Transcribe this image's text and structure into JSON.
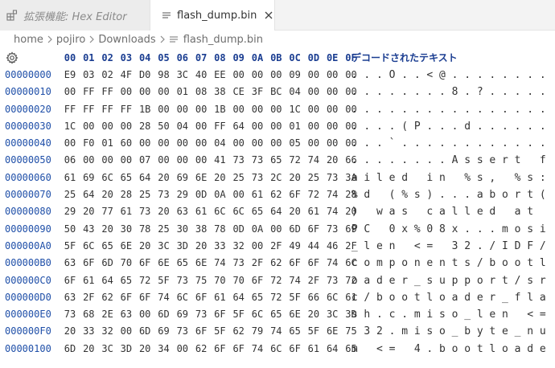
{
  "tabs": [
    {
      "label": "拡張機能: Hex Editor",
      "icon": "extensions-icon",
      "active": false
    },
    {
      "label": "flash_dump.bin",
      "icon": "file-icon",
      "active": true,
      "close": "close-icon"
    }
  ],
  "breadcrumb": [
    "home",
    "pojiro",
    "Downloads",
    "flash_dump.bin"
  ],
  "editor": {
    "column_headers": [
      "00",
      "01",
      "02",
      "03",
      "04",
      "05",
      "06",
      "07",
      "08",
      "09",
      "0A",
      "0B",
      "0C",
      "0D",
      "0E",
      "0F"
    ],
    "decoded_header": "デコードされたテキスト",
    "rows": [
      {
        "addr": "00000000",
        "hex": [
          "E9",
          "03",
          "02",
          "4F",
          "D0",
          "98",
          "3C",
          "40",
          "EE",
          "00",
          "00",
          "00",
          "09",
          "00",
          "00",
          "00"
        ],
        "ascii": [
          ".",
          ".",
          ".",
          "O",
          ".",
          ".",
          "<",
          "@",
          ".",
          ".",
          ".",
          ".",
          ".",
          ".",
          ".",
          "."
        ]
      },
      {
        "addr": "00000010",
        "hex": [
          "00",
          "FF",
          "FF",
          "00",
          "00",
          "00",
          "01",
          "08",
          "38",
          "CE",
          "3F",
          "BC",
          "04",
          "00",
          "00",
          "00"
        ],
        "ascii": [
          ".",
          ".",
          ".",
          ".",
          ".",
          ".",
          ".",
          ".",
          "8",
          ".",
          "?",
          ".",
          ".",
          ".",
          ".",
          "."
        ]
      },
      {
        "addr": "00000020",
        "hex": [
          "FF",
          "FF",
          "FF",
          "FF",
          "1B",
          "00",
          "00",
          "00",
          "1B",
          "00",
          "00",
          "00",
          "1C",
          "00",
          "00",
          "00"
        ],
        "ascii": [
          ".",
          ".",
          ".",
          ".",
          ".",
          ".",
          ".",
          ".",
          ".",
          ".",
          ".",
          ".",
          ".",
          ".",
          ".",
          "."
        ]
      },
      {
        "addr": "00000030",
        "hex": [
          "1C",
          "00",
          "00",
          "00",
          "28",
          "50",
          "04",
          "00",
          "FF",
          "64",
          "00",
          "00",
          "01",
          "00",
          "00",
          "00"
        ],
        "ascii": [
          ".",
          ".",
          ".",
          ".",
          "(",
          "P",
          ".",
          ".",
          ".",
          "d",
          ".",
          ".",
          ".",
          ".",
          ".",
          "."
        ]
      },
      {
        "addr": "00000040",
        "hex": [
          "00",
          "F0",
          "01",
          "60",
          "00",
          "00",
          "00",
          "00",
          "04",
          "00",
          "00",
          "00",
          "05",
          "00",
          "00",
          "00"
        ],
        "ascii": [
          ".",
          ".",
          ".",
          "`",
          ".",
          ".",
          ".",
          ".",
          ".",
          ".",
          ".",
          ".",
          ".",
          ".",
          ".",
          "."
        ]
      },
      {
        "addr": "00000050",
        "hex": [
          "06",
          "00",
          "00",
          "00",
          "07",
          "00",
          "00",
          "00",
          "41",
          "73",
          "73",
          "65",
          "72",
          "74",
          "20",
          "66"
        ],
        "ascii": [
          ".",
          ".",
          ".",
          ".",
          ".",
          ".",
          ".",
          ".",
          "A",
          "s",
          "s",
          "e",
          "r",
          "t",
          " ",
          "f"
        ]
      },
      {
        "addr": "00000060",
        "hex": [
          "61",
          "69",
          "6C",
          "65",
          "64",
          "20",
          "69",
          "6E",
          "20",
          "25",
          "73",
          "2C",
          "20",
          "25",
          "73",
          "3A"
        ],
        "ascii": [
          "a",
          "i",
          "l",
          "e",
          "d",
          " ",
          "i",
          "n",
          " ",
          "%",
          "s",
          ",",
          " ",
          "%",
          "s",
          ":"
        ]
      },
      {
        "addr": "00000070",
        "hex": [
          "25",
          "64",
          "20",
          "28",
          "25",
          "73",
          "29",
          "0D",
          "0A",
          "00",
          "61",
          "62",
          "6F",
          "72",
          "74",
          "28"
        ],
        "ascii": [
          "%",
          "d",
          " ",
          "(",
          "%",
          "s",
          ")",
          ".",
          ".",
          ".",
          "a",
          "b",
          "o",
          "r",
          "t",
          "("
        ]
      },
      {
        "addr": "00000080",
        "hex": [
          "29",
          "20",
          "77",
          "61",
          "73",
          "20",
          "63",
          "61",
          "6C",
          "6C",
          "65",
          "64",
          "20",
          "61",
          "74",
          "20"
        ],
        "ascii": [
          ")",
          " ",
          "w",
          "a",
          "s",
          " ",
          "c",
          "a",
          "l",
          "l",
          "e",
          "d",
          " ",
          "a",
          "t",
          " "
        ]
      },
      {
        "addr": "00000090",
        "hex": [
          "50",
          "43",
          "20",
          "30",
          "78",
          "25",
          "30",
          "38",
          "78",
          "0D",
          "0A",
          "00",
          "6D",
          "6F",
          "73",
          "69"
        ],
        "ascii": [
          "P",
          "C",
          " ",
          "0",
          "x",
          "%",
          "0",
          "8",
          "x",
          ".",
          ".",
          ".",
          "m",
          "o",
          "s",
          "i"
        ]
      },
      {
        "addr": "000000A0",
        "hex": [
          "5F",
          "6C",
          "65",
          "6E",
          "20",
          "3C",
          "3D",
          "20",
          "33",
          "32",
          "00",
          "2F",
          "49",
          "44",
          "46",
          "2F"
        ],
        "ascii": [
          "_",
          "l",
          "e",
          "n",
          " ",
          "<",
          "=",
          " ",
          "3",
          "2",
          ".",
          "/",
          "I",
          "D",
          "F",
          "/"
        ]
      },
      {
        "addr": "000000B0",
        "hex": [
          "63",
          "6F",
          "6D",
          "70",
          "6F",
          "6E",
          "65",
          "6E",
          "74",
          "73",
          "2F",
          "62",
          "6F",
          "6F",
          "74",
          "6C"
        ],
        "ascii": [
          "c",
          "o",
          "m",
          "p",
          "o",
          "n",
          "e",
          "n",
          "t",
          "s",
          "/",
          "b",
          "o",
          "o",
          "t",
          "l"
        ]
      },
      {
        "addr": "000000C0",
        "hex": [
          "6F",
          "61",
          "64",
          "65",
          "72",
          "5F",
          "73",
          "75",
          "70",
          "70",
          "6F",
          "72",
          "74",
          "2F",
          "73",
          "72"
        ],
        "ascii": [
          "o",
          "a",
          "d",
          "e",
          "r",
          "_",
          "s",
          "u",
          "p",
          "p",
          "o",
          "r",
          "t",
          "/",
          "s",
          "r"
        ]
      },
      {
        "addr": "000000D0",
        "hex": [
          "63",
          "2F",
          "62",
          "6F",
          "6F",
          "74",
          "6C",
          "6F",
          "61",
          "64",
          "65",
          "72",
          "5F",
          "66",
          "6C",
          "61"
        ],
        "ascii": [
          "c",
          "/",
          "b",
          "o",
          "o",
          "t",
          "l",
          "o",
          "a",
          "d",
          "e",
          "r",
          "_",
          "f",
          "l",
          "a"
        ]
      },
      {
        "addr": "000000E0",
        "hex": [
          "73",
          "68",
          "2E",
          "63",
          "00",
          "6D",
          "69",
          "73",
          "6F",
          "5F",
          "6C",
          "65",
          "6E",
          "20",
          "3C",
          "3D"
        ],
        "ascii": [
          "s",
          "h",
          ".",
          "c",
          ".",
          "m",
          "i",
          "s",
          "o",
          "_",
          "l",
          "e",
          "n",
          " ",
          "<",
          "="
        ]
      },
      {
        "addr": "000000F0",
        "hex": [
          "20",
          "33",
          "32",
          "00",
          "6D",
          "69",
          "73",
          "6F",
          "5F",
          "62",
          "79",
          "74",
          "65",
          "5F",
          "6E",
          "75"
        ],
        "ascii": [
          " ",
          "3",
          "2",
          ".",
          "m",
          "i",
          "s",
          "o",
          "_",
          "b",
          "y",
          "t",
          "e",
          "_",
          "n",
          "u"
        ]
      },
      {
        "addr": "00000100",
        "hex": [
          "6D",
          "20",
          "3C",
          "3D",
          "20",
          "34",
          "00",
          "62",
          "6F",
          "6F",
          "74",
          "6C",
          "6F",
          "61",
          "64",
          "65"
        ],
        "ascii": [
          "m",
          " ",
          "<",
          "=",
          " ",
          "4",
          ".",
          "b",
          "o",
          "o",
          "t",
          "l",
          "o",
          "a",
          "d",
          "e"
        ]
      }
    ]
  }
}
